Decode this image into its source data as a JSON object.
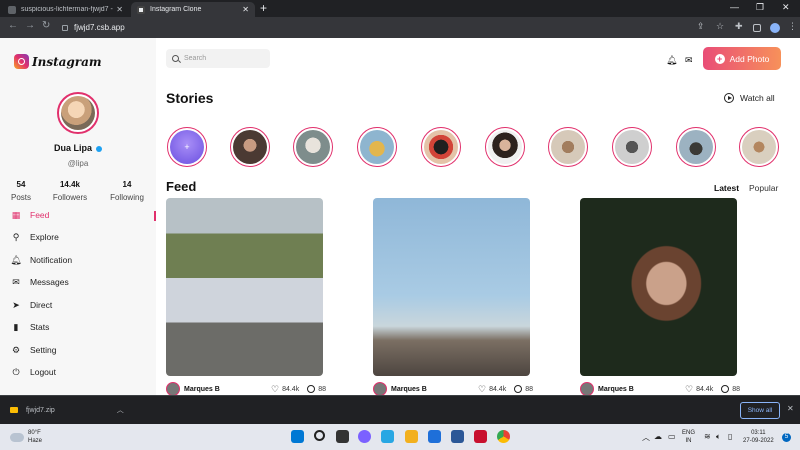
{
  "browser": {
    "tabs": [
      {
        "title": "suspicious-lichterman-fjwjd7 - C"
      },
      {
        "title": "Instagram Clone"
      }
    ],
    "url": "fjwjd7.csb.app"
  },
  "sidebar": {
    "logo": "Instagram",
    "profile": {
      "name": "Dua Lipa",
      "handle": "@lipa"
    },
    "stats": [
      {
        "value": "54",
        "label": "Posts"
      },
      {
        "value": "14.4k",
        "label": "Followers"
      },
      {
        "value": "14",
        "label": "Following"
      }
    ],
    "menu": [
      {
        "label": "Feed",
        "icon": "grid-icon"
      },
      {
        "label": "Explore",
        "icon": "search-icon"
      },
      {
        "label": "Notification",
        "icon": "bell-icon"
      },
      {
        "label": "Messages",
        "icon": "mail-icon"
      },
      {
        "label": "Direct",
        "icon": "send-icon"
      },
      {
        "label": "Stats",
        "icon": "bar-chart-icon"
      },
      {
        "label": "Setting",
        "icon": "gear-icon"
      },
      {
        "label": "Logout",
        "icon": "logout-icon"
      }
    ]
  },
  "header": {
    "search_placeholder": "Search",
    "add_photo": "Add Photo"
  },
  "stories": {
    "title": "Stories",
    "watch_all": "Watch all"
  },
  "feed": {
    "title": "Feed",
    "tabs": {
      "latest": "Latest",
      "popular": "Popular"
    },
    "posts": [
      {
        "author": "Marques B",
        "likes": "84.4k",
        "comments": "88"
      },
      {
        "author": "Marques B",
        "likes": "84.4k",
        "comments": "88"
      },
      {
        "author": "Marques B",
        "likes": "84.4k",
        "comments": "88"
      }
    ]
  },
  "downloads": {
    "file": "fjwjd7.zip",
    "show_all": "Show all"
  },
  "taskbar": {
    "weather": {
      "temp": "80°F",
      "condition": "Haze"
    },
    "lang": {
      "line1": "ENG",
      "line2": "IN"
    },
    "clock": {
      "time": "03:11",
      "date": "27-09-2022"
    },
    "notifications": "5"
  },
  "colors": {
    "accent": "#e1306c",
    "button_gradient_start": "#e94d77",
    "button_gradient_end": "#f7915a",
    "verified": "#1da1f2"
  }
}
